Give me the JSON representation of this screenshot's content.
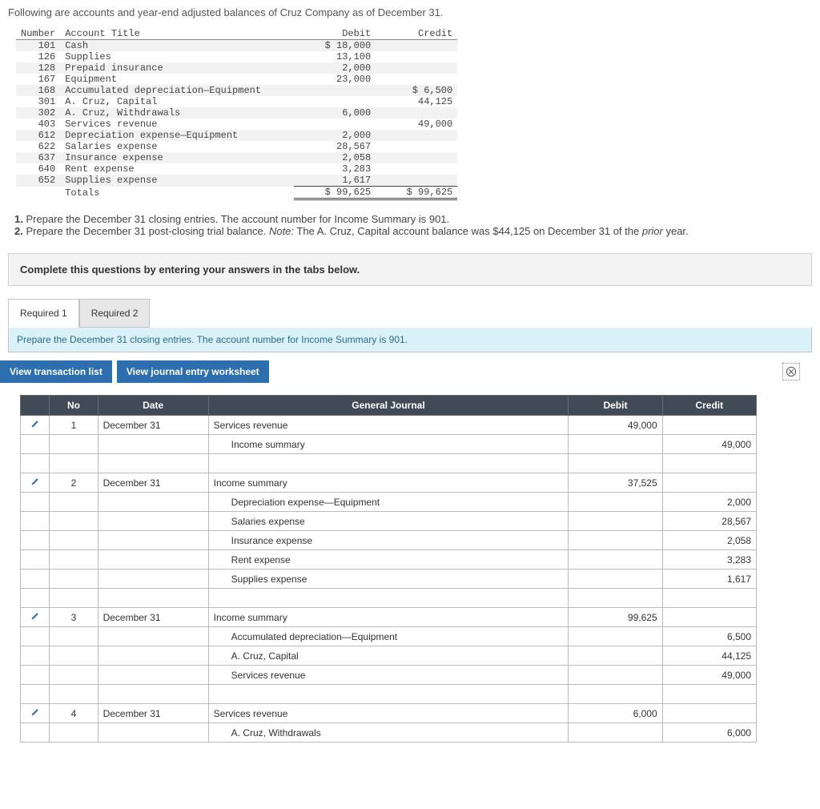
{
  "intro": "Following are accounts and year-end adjusted balances of Cruz Company as of December 31.",
  "tb": {
    "head": {
      "c1": "Number",
      "c2": "Account Title",
      "c3": "Debit",
      "c4": "Credit"
    },
    "rows": [
      {
        "n": "101",
        "t": "Cash",
        "d": "$ 18,000",
        "c": ""
      },
      {
        "n": "126",
        "t": "Supplies",
        "d": "13,100",
        "c": ""
      },
      {
        "n": "128",
        "t": "Prepaid insurance",
        "d": "2,000",
        "c": ""
      },
      {
        "n": "167",
        "t": "Equipment",
        "d": "23,000",
        "c": ""
      },
      {
        "n": "168",
        "t": "Accumulated depreciation—Equipment",
        "d": "",
        "c": "$ 6,500"
      },
      {
        "n": "301",
        "t": "A. Cruz, Capital",
        "d": "",
        "c": "44,125"
      },
      {
        "n": "302",
        "t": "A. Cruz, Withdrawals",
        "d": "6,000",
        "c": ""
      },
      {
        "n": "403",
        "t": "Services revenue",
        "d": "",
        "c": "49,000"
      },
      {
        "n": "612",
        "t": "Depreciation expense—Equipment",
        "d": "2,000",
        "c": ""
      },
      {
        "n": "622",
        "t": "Salaries expense",
        "d": "28,567",
        "c": ""
      },
      {
        "n": "637",
        "t": "Insurance expense",
        "d": "2,058",
        "c": ""
      },
      {
        "n": "640",
        "t": "Rent expense",
        "d": "3,283",
        "c": ""
      },
      {
        "n": "652",
        "t": "Supplies expense",
        "d": "1,617",
        "c": ""
      }
    ],
    "tot": {
      "t": "Totals",
      "d": "$ 99,625",
      "c": "$ 99,625"
    }
  },
  "tasks": {
    "t1a": "1.",
    "t1b": " Prepare the December 31 closing entries. The account number for Income Summary is 901.",
    "t2a": "2.",
    "t2b": " Prepare the December 31 post-closing trial balance. ",
    "note": "Note:",
    "t2c": " The A. Cruz, Capital account balance was $44,125 on December 31 of the ",
    "prior": "prior",
    "t2d": " year."
  },
  "panel": "Complete this questions by entering your answers in the tabs below.",
  "tabs": {
    "t1": "Required 1",
    "t2": "Required 2"
  },
  "tabInstr": "Prepare the December 31 closing entries. The account number for Income Summary is 901.",
  "buttons": {
    "b1": "View transaction list",
    "b2": "View journal entry worksheet"
  },
  "jhead": {
    "no": "No",
    "date": "Date",
    "gj": "General Journal",
    "debit": "Debit",
    "credit": "Credit"
  },
  "jr": [
    {
      "p": true,
      "no": "1",
      "date": "December 31",
      "acc": "Services revenue",
      "d": "49,000",
      "c": ""
    },
    {
      "p": false,
      "no": "",
      "date": "",
      "acc": "Income summary",
      "d": "",
      "c": "49,000",
      "ind": true
    },
    {
      "blank": true
    },
    {
      "p": true,
      "no": "2",
      "date": "December 31",
      "acc": "Income summary",
      "d": "37,525",
      "c": ""
    },
    {
      "p": false,
      "no": "",
      "date": "",
      "acc": "Depreciation expense—Equipment",
      "d": "",
      "c": "2,000",
      "ind": true
    },
    {
      "p": false,
      "no": "",
      "date": "",
      "acc": "Salaries expense",
      "d": "",
      "c": "28,567",
      "ind": true
    },
    {
      "p": false,
      "no": "",
      "date": "",
      "acc": "Insurance expense",
      "d": "",
      "c": "2,058",
      "ind": true
    },
    {
      "p": false,
      "no": "",
      "date": "",
      "acc": "Rent expense",
      "d": "",
      "c": "3,283",
      "ind": true
    },
    {
      "p": false,
      "no": "",
      "date": "",
      "acc": "Supplies expense",
      "d": "",
      "c": "1,617",
      "ind": true
    },
    {
      "blank": true
    },
    {
      "p": true,
      "no": "3",
      "date": "December 31",
      "acc": "Income summary",
      "d": "99,625",
      "c": ""
    },
    {
      "p": false,
      "no": "",
      "date": "",
      "acc": "Accumulated depreciation—Equipment",
      "d": "",
      "c": "6,500",
      "ind": true
    },
    {
      "p": false,
      "no": "",
      "date": "",
      "acc": "A. Cruz, Capital",
      "d": "",
      "c": "44,125",
      "ind": true
    },
    {
      "p": false,
      "no": "",
      "date": "",
      "acc": "Services revenue",
      "d": "",
      "c": "49,000",
      "ind": true
    },
    {
      "blank": true
    },
    {
      "p": true,
      "no": "4",
      "date": "December 31",
      "acc": "Services revenue",
      "d": "6,000",
      "c": ""
    },
    {
      "p": false,
      "no": "",
      "date": "",
      "acc": "A. Cruz, Withdrawals",
      "d": "",
      "c": "6,000",
      "ind": true
    }
  ]
}
